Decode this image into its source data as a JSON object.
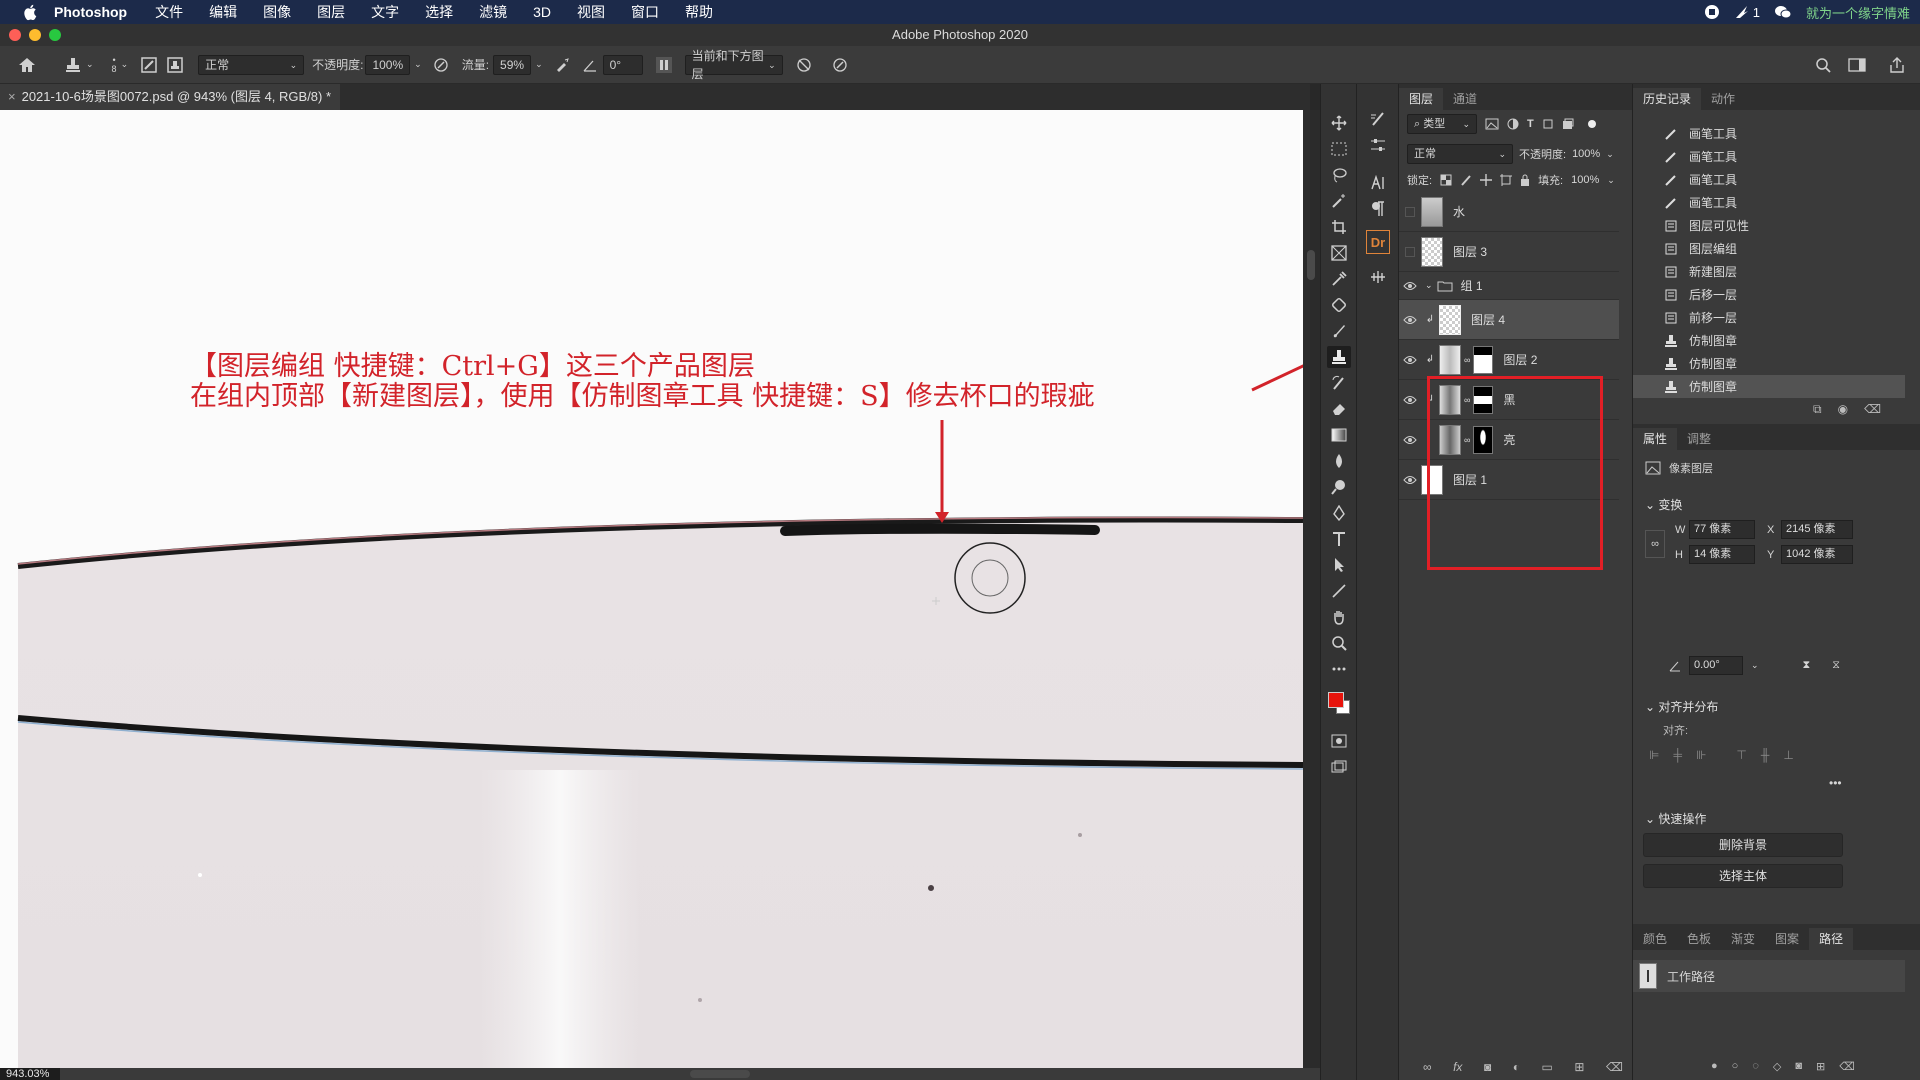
{
  "menubar": {
    "app": "Photoshop",
    "items": [
      "文件",
      "编辑",
      "图像",
      "图层",
      "文字",
      "选择",
      "滤镜",
      "3D",
      "视图",
      "窗口",
      "帮助"
    ],
    "status_count": "1",
    "right_text": "就为一个缘字情难"
  },
  "window": {
    "title": "Adobe Photoshop 2020"
  },
  "options": {
    "brush_size": "8",
    "mode": "正常",
    "opacity_label": "不透明度:",
    "opacity": "100%",
    "flow_label": "流量:",
    "flow": "59%",
    "angle": "0°",
    "sample": "当前和下方图层"
  },
  "document": {
    "tab_title": "2021-10-6场景图0072.psd @ 943% (图层 4, RGB/8) *",
    "zoom": "943.03%",
    "close": "×"
  },
  "annotation": {
    "line1": "【图层编组 快捷键：Ctrl+G】这三个产品图层",
    "line2": "在组内顶部【新建图层】，使用【仿制图章工具 快捷键：S】修去杯口的瑕疵"
  },
  "layers_panel": {
    "tabs": [
      "图层",
      "通道"
    ],
    "filter": "类型",
    "blend_mode": "正常",
    "opacity_label": "不透明度:",
    "opacity": "100%",
    "lock_label": "锁定:",
    "fill_label": "填充:",
    "fill": "100%",
    "layers": [
      {
        "name": "水",
        "visible": false
      },
      {
        "name": "图层 3",
        "visible": false
      },
      {
        "name": "组 1",
        "visible": true
      },
      {
        "name": "图层 4",
        "visible": true
      },
      {
        "name": "图层 2",
        "visible": true
      },
      {
        "name": "黑",
        "visible": true
      },
      {
        "name": "亮",
        "visible": true
      },
      {
        "name": "图层 1",
        "visible": true
      }
    ]
  },
  "history_panel": {
    "tabs": [
      "历史记录",
      "动作"
    ],
    "items": [
      "画笔工具",
      "画笔工具",
      "画笔工具",
      "画笔工具",
      "图层可见性",
      "图层编组",
      "新建图层",
      "后移一层",
      "前移一层",
      "仿制图章",
      "仿制图章",
      "仿制图章"
    ]
  },
  "properties_panel": {
    "tabs": [
      "属性",
      "调整"
    ],
    "kind": "像素图层",
    "transform_label": "变换",
    "w_label": "W",
    "w": "77 像素",
    "x_label": "X",
    "x": "2145 像素",
    "h_label": "H",
    "h": "14 像素",
    "y_label": "Y",
    "y": "1042 像素",
    "angle": "0.00°",
    "align_label": "对齐并分布",
    "align_sub": "对齐:",
    "quick_label": "快速操作",
    "remove_bg": "删除背景",
    "select_subject": "选择主体"
  },
  "bottom_panel": {
    "tabs": [
      "颜色",
      "色板",
      "渐变",
      "图案",
      "路径"
    ],
    "path_item": "工作路径"
  },
  "colors": {
    "foreground": "#e8140c",
    "background": "#ffffff",
    "annotation": "#d2232a",
    "highlight_box": "#e21f26"
  }
}
